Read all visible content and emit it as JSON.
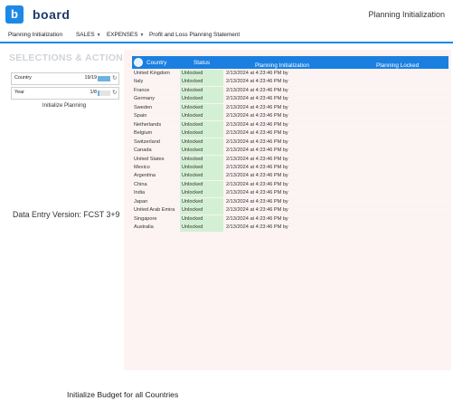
{
  "header": {
    "logo_letter": "b",
    "logo_text": "board",
    "screen_title": "Planning Initialization"
  },
  "nav": {
    "items": [
      {
        "label": "Planning Initialization",
        "has_dropdown": false
      },
      {
        "label": "SALES",
        "has_dropdown": true
      },
      {
        "label": "EXPENSES",
        "has_dropdown": true
      },
      {
        "label": "Profit and Loss Planning Statement",
        "has_dropdown": false
      }
    ],
    "accent_color": "#1e88e5"
  },
  "left_panel": {
    "title": "SELECTIONS & ACTIONS",
    "selectors": [
      {
        "label": "Country",
        "count": "19/19",
        "fill": 1.0,
        "icon": "reset-icon"
      },
      {
        "label": "Year",
        "count": "1/8",
        "fill": 0.125,
        "icon": "reset-icon"
      }
    ],
    "action_label": "Initialize Planning",
    "version_text": "Data Entry Version: FCST 3+9"
  },
  "grid": {
    "header_color": "#1a7fe0",
    "columns": {
      "country": "Country",
      "status": "Status",
      "planning_initialization": "Planning Initialization",
      "planning_locked": "Planning Locked"
    },
    "rows": [
      {
        "country": "United Kingdom",
        "status": "Unlocked",
        "init": "2/13/2024 at 4:23:46 PM by",
        "locked": ""
      },
      {
        "country": "Italy",
        "status": "Unlocked",
        "init": "2/13/2024 at 4:23:46 PM by",
        "locked": ""
      },
      {
        "country": "France",
        "status": "Unlocked",
        "init": "2/13/2024 at 4:23:46 PM by",
        "locked": ""
      },
      {
        "country": "Germany",
        "status": "Unlocked",
        "init": "2/13/2024 at 4:23:46 PM by",
        "locked": ""
      },
      {
        "country": "Sweden",
        "status": "Unlocked",
        "init": "2/13/2024 at 4:23:46 PM by",
        "locked": ""
      },
      {
        "country": "Spain",
        "status": "Unlocked",
        "init": "2/13/2024 at 4:23:46 PM by",
        "locked": ""
      },
      {
        "country": "Netherlands",
        "status": "Unlocked",
        "init": "2/13/2024 at 4:23:46 PM by",
        "locked": ""
      },
      {
        "country": "Belgium",
        "status": "Unlocked",
        "init": "2/13/2024 at 4:23:46 PM by",
        "locked": ""
      },
      {
        "country": "Switzerland",
        "status": "Unlocked",
        "init": "2/13/2024 at 4:23:46 PM by",
        "locked": ""
      },
      {
        "country": "Canada",
        "status": "Unlocked",
        "init": "2/13/2024 at 4:23:46 PM by",
        "locked": ""
      },
      {
        "country": "United States",
        "status": "Unlocked",
        "init": "2/13/2024 at 4:23:46 PM by",
        "locked": ""
      },
      {
        "country": "Mexico",
        "status": "Unlocked",
        "init": "2/13/2024 at 4:23:46 PM by",
        "locked": ""
      },
      {
        "country": "Argentina",
        "status": "Unlocked",
        "init": "2/13/2024 at 4:23:46 PM by",
        "locked": ""
      },
      {
        "country": "China",
        "status": "Unlocked",
        "init": "2/13/2024 at 4:23:46 PM by",
        "locked": ""
      },
      {
        "country": "India",
        "status": "Unlocked",
        "init": "2/13/2024 at 4:23:46 PM by",
        "locked": ""
      },
      {
        "country": "Japan",
        "status": "Unlocked",
        "init": "2/13/2024 at 4:23:46 PM by",
        "locked": ""
      },
      {
        "country": "United Arab Emira",
        "status": "Unlocked",
        "init": "2/13/2024 at 4:23:46 PM by",
        "locked": ""
      },
      {
        "country": "Singapore",
        "status": "Unlocked",
        "init": "2/13/2024 at 4:23:46 PM by",
        "locked": ""
      },
      {
        "country": "Australia",
        "status": "Unlocked",
        "init": "2/13/2024 at 4:23:46 PM by",
        "locked": ""
      }
    ]
  },
  "footer": {
    "caption": "Initialize Budget for all Countries"
  }
}
